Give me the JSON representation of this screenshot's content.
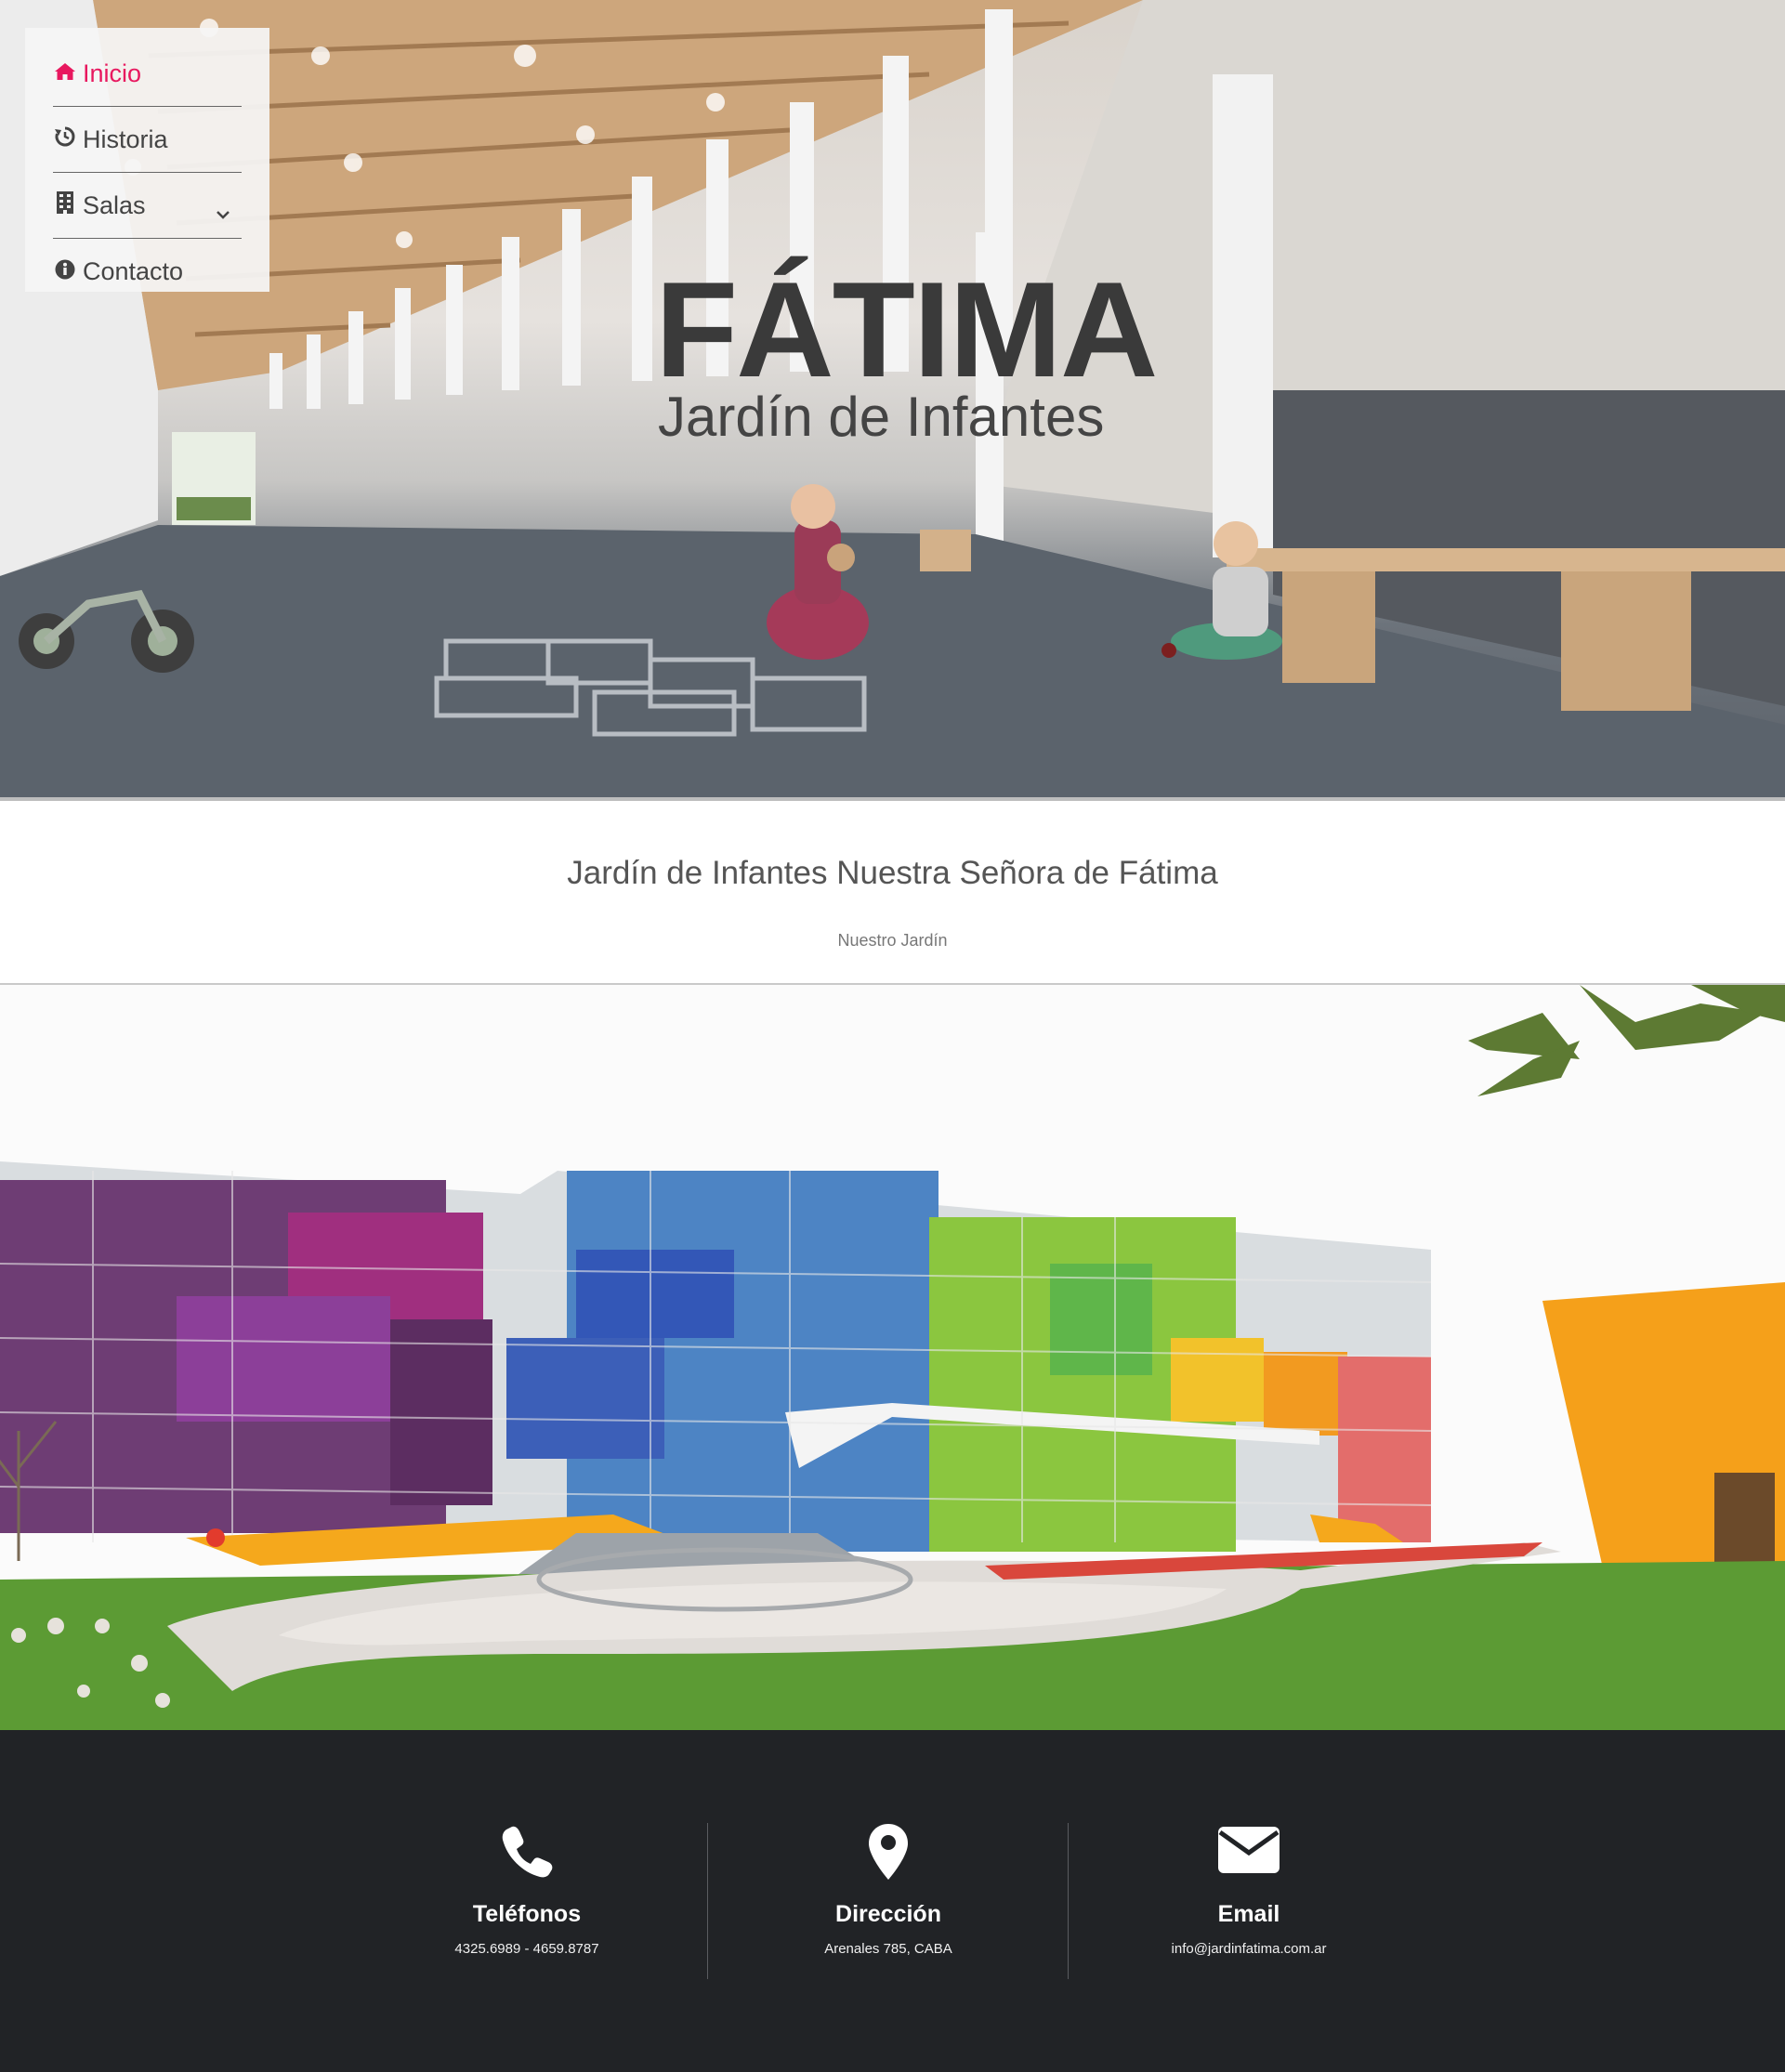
{
  "nav": {
    "items": [
      {
        "label": "Inicio",
        "icon": "home-icon"
      },
      {
        "label": "Historia",
        "icon": "history-icon"
      },
      {
        "label": "Salas",
        "icon": "building-icon"
      },
      {
        "label": "Contacto",
        "icon": "info-icon"
      }
    ],
    "active": "Inicio",
    "accent_color": "#e8185f"
  },
  "hero": {
    "title": "FÁTIMA",
    "subtitle": "Jardín de Infantes"
  },
  "intro": {
    "title": "Jardín de Infantes Nuestra Señora de Fátima",
    "subtitle": "Nuestro Jardín"
  },
  "footer": {
    "background": "#212326",
    "contacts": [
      {
        "label": "Teléfonos",
        "value": "4325.6989 - 4659.8787",
        "icon": "phone-icon"
      },
      {
        "label": "Dirección",
        "value": "Arenales 785, CABA",
        "icon": "map-marker-icon"
      },
      {
        "label": "Email",
        "value": "info@jardinfatima.com.ar",
        "icon": "envelope-icon"
      }
    ]
  }
}
